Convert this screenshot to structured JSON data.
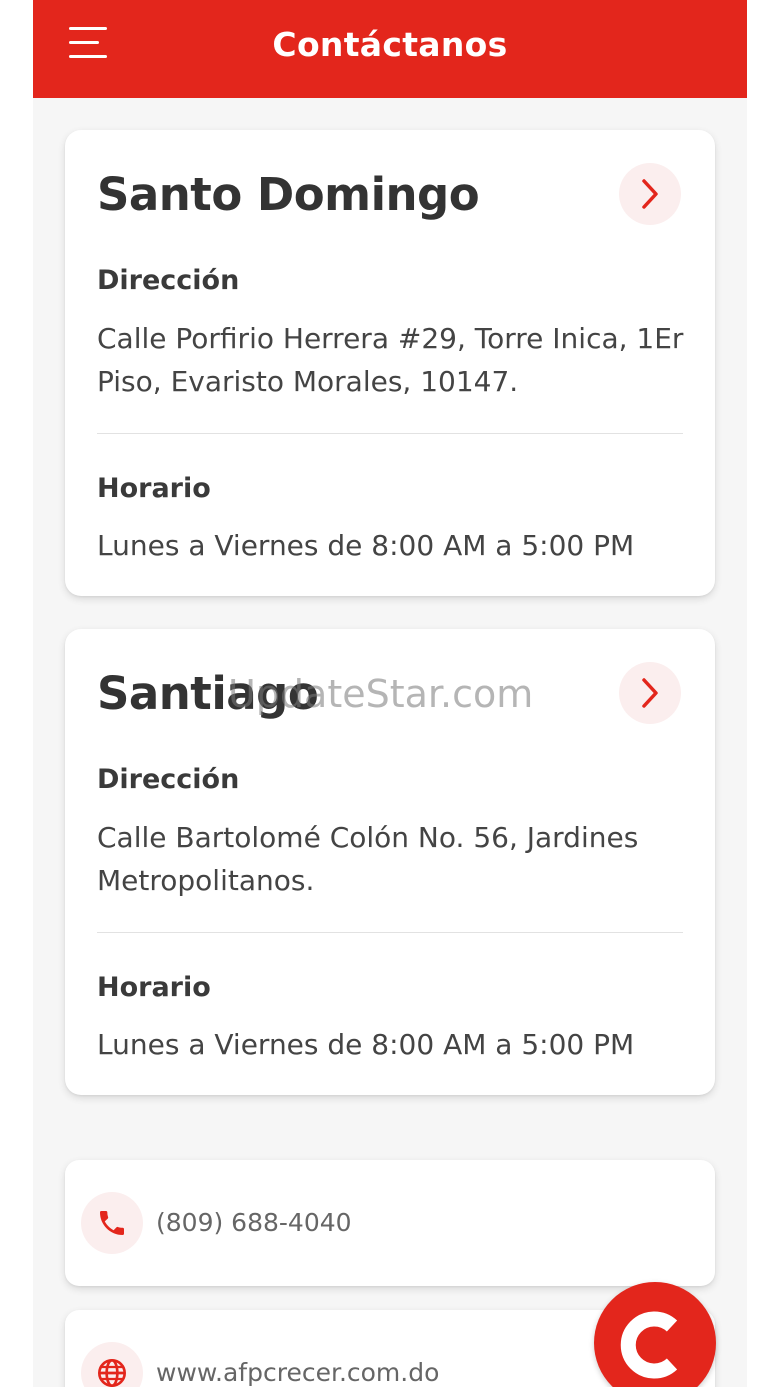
{
  "header": {
    "title": "Contáctanos",
    "menu_icon": "hamburger-menu-icon"
  },
  "offices": [
    {
      "name": "Santo Domingo",
      "address_label": "Dirección",
      "address": "Calle Porfirio Herrera #29, Torre Inica, 1Er Piso, Evaristo Morales, 10147.",
      "hours_label": "Horario",
      "hours": "Lunes a Viernes de 8:00 AM a 5:00 PM"
    },
    {
      "name": "Santiago",
      "address_label": "Dirección",
      "address": "Calle Bartolomé Colón No. 56, Jardines Metropolitanos.",
      "hours_label": "Horario",
      "hours": "Lunes a Viernes de 8:00 AM a 5:00 PM"
    }
  ],
  "contact": {
    "phone": "(809) 688-4040",
    "website": "www.afpcrecer.com.do"
  },
  "watermark": "UpdateStar.com",
  "colors": {
    "brand_red": "#e3261c",
    "icon_bg": "#fbeeee",
    "text_dark": "#333333",
    "background": "#f6f6f6"
  }
}
